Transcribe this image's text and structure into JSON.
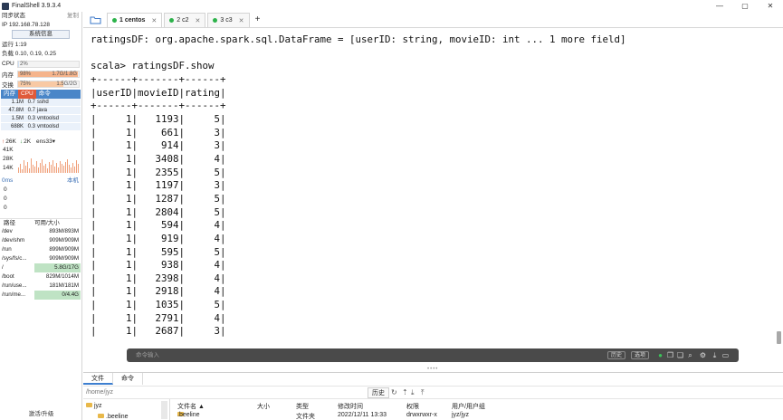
{
  "window": {
    "title": "FinalShell 3.9.3.4",
    "controls": [
      "—",
      "▢",
      "✕"
    ]
  },
  "sidebar": {
    "sync_status": "同步状态",
    "copy_label": "复制",
    "ip": "IP 192.168.78.128",
    "sysinfo_button": "系统信息",
    "uptime": "运行 1:19",
    "load": "负载 0.10, 0.19, 0.25",
    "cpu": {
      "label": "CPU",
      "text": "2%",
      "percent": 2
    },
    "mem": {
      "label": "内存",
      "text": "98%",
      "detail": "1.7G/1.8G",
      "percent": 98
    },
    "swap": {
      "label": "交换",
      "text": "75%",
      "detail": "1.5G/2G",
      "percent": 75
    },
    "proc_tabs": [
      "内存",
      "CPU",
      "命令"
    ],
    "processes": [
      {
        "mem": "1.1M",
        "cpu": "0.7",
        "cmd": "sshd"
      },
      {
        "mem": "47.8M",
        "cpu": "0.7",
        "cmd": "java"
      },
      {
        "mem": "1.5M",
        "cpu": "0.3",
        "cmd": "vmtoolsd"
      },
      {
        "mem": "688K",
        "cpu": "0.3",
        "cmd": "vmtoolsd"
      }
    ],
    "net": {
      "up": "26K",
      "down": "2K",
      "iface": "ens33",
      "y_labels": [
        "41K",
        "28K",
        "14K"
      ]
    },
    "latency": {
      "label": "0ms",
      "right": "本机",
      "values": [
        "0",
        "0",
        "0"
      ]
    },
    "disk_headers": [
      "路径",
      "可用/大小"
    ],
    "disks": [
      {
        "path": "/dev",
        "size": "893M/893M"
      },
      {
        "path": "/dev/shm",
        "size": "909M/909M"
      },
      {
        "path": "/run",
        "size": "899M/909M"
      },
      {
        "path": "/sys/fs/c...",
        "size": "909M/909M"
      },
      {
        "path": "/",
        "size": "5.8G/17G"
      },
      {
        "path": "/boot",
        "size": "829M/1014M"
      },
      {
        "path": "/run/use...",
        "size": "181M/181M"
      },
      {
        "path": "/run/me...",
        "size": "0/4.4G"
      }
    ],
    "upgrade": "激活/升级"
  },
  "tabs": [
    {
      "label": "1 centos",
      "active": true
    },
    {
      "label": "2 c2",
      "active": false
    },
    {
      "label": "3 c3",
      "active": false
    }
  ],
  "terminal": {
    "lines": [
      "ratingsDF: org.apache.spark.sql.DataFrame = [userID: string, movieID: int ... 1 more field]",
      "",
      "scala> ratingsDF.show",
      "+------+-------+------+",
      "|userID|movieID|rating|",
      "+------+-------+------+",
      "|     1|   1193|     5|",
      "|     1|    661|     3|",
      "|     1|    914|     3|",
      "|     1|   3408|     4|",
      "|     1|   2355|     5|",
      "|     1|   1197|     3|",
      "|     1|   1287|     5|",
      "|     1|   2804|     5|",
      "|     1|    594|     4|",
      "|     1|    919|     4|",
      "|     1|    595|     5|",
      "|     1|    938|     4|",
      "|     1|   2398|     4|",
      "|     1|   2918|     4|",
      "|     1|   1035|     5|",
      "|     1|   2791|     4|",
      "|     1|   2687|     3|"
    ]
  },
  "command_bar": {
    "placeholder": "命令输入",
    "history_button": "历史",
    "options_button": "选项"
  },
  "bottom": {
    "tabs": [
      "文件",
      "命令"
    ],
    "path": "/home/jyz",
    "history_button": "历史",
    "tree_root": "jyz",
    "tree_child": ".beeline",
    "file_headers": [
      "文件名 ▲",
      "大小",
      "类型",
      "修改时间",
      "权限",
      "用户/用户组"
    ],
    "file_row": {
      "name": ".beeline",
      "size": "",
      "type": "文件夹",
      "modified": "2022/12/11 13:33",
      "perm": "drwxrwxr-x",
      "owner": "jyz/jyz"
    }
  }
}
